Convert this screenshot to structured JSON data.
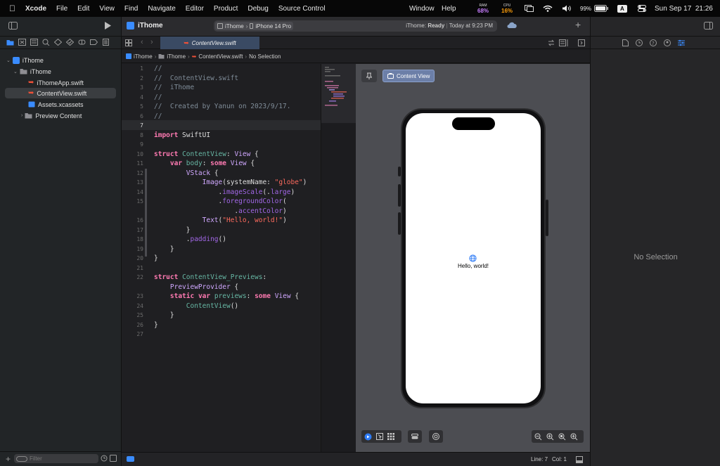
{
  "menubar": {
    "app": "Xcode",
    "items": [
      "File",
      "Edit",
      "View",
      "Find",
      "Navigate",
      "Editor",
      "Product",
      "Debug",
      "Source Control"
    ],
    "right_items": [
      "Window",
      "Help"
    ],
    "ram_label": "RAM",
    "ram_value": "68%",
    "cpu_label": "CPU",
    "cpu_value": "16%",
    "battery": "99%",
    "input_indicator": "A",
    "clock": "Sun Sep 17  21:26"
  },
  "toolbar": {
    "project": "iThome",
    "scheme": "iThome",
    "destination": "iPhone 14 Pro",
    "status_prefix": "iThome:",
    "status_state": "Ready",
    "status_time": "Today at 9:23 PM"
  },
  "navigator": {
    "tree": [
      {
        "label": "iThome",
        "icon": "project-icon"
      },
      {
        "label": "iThome",
        "icon": "folder-icon"
      },
      {
        "label": "iThomeApp.swift",
        "icon": "swift-file-icon"
      },
      {
        "label": "ContentView.swift",
        "icon": "swift-file-icon"
      },
      {
        "label": "Assets.xcassets",
        "icon": "asset-catalog-icon"
      },
      {
        "label": "Preview Content",
        "icon": "folder-icon"
      }
    ],
    "filter_placeholder": "Filter"
  },
  "editor": {
    "tab": "ContentView.swift",
    "jump_bar": [
      "iThome",
      "iThome",
      "ContentView.swift",
      "No Selection"
    ],
    "line_numbers": [
      "1",
      "2",
      "3",
      "4",
      "5",
      "6",
      "7",
      "8",
      "9",
      "10",
      "11",
      "12",
      "13",
      "14",
      "15",
      "",
      "16",
      "17",
      "18",
      "19",
      "20",
      "21",
      "22",
      "",
      "23",
      "24",
      "25",
      "26",
      "27"
    ],
    "code_lines": [
      "//",
      "//  ContentView.swift",
      "//  iThome",
      "//",
      "//  Created by Yanun on 2023/9/17.",
      "//",
      "",
      "import SwiftUI",
      "",
      "struct ContentView: View {",
      "    var body: some View {",
      "        VStack {",
      "            Image(systemName: \"globe\")",
      "                .imageScale(.large)",
      "                .foregroundColor(",
      "                    .accentColor)",
      "            Text(\"Hello, world!\")",
      "        }",
      "        .padding()",
      "    }",
      "}",
      "",
      "struct ContentView_Previews:",
      "    PreviewProvider {",
      "    static var previews: some View {",
      "        ContentView()",
      "    }",
      "}",
      ""
    ],
    "status_line": "Line: 7",
    "status_col": "Col: 1"
  },
  "canvas": {
    "preview_label": "Content View",
    "preview_text": "Hello, world!",
    "globe_icon": "globe-icon",
    "accent_color": "#2f7cf6"
  },
  "inspector": {
    "empty_label": "No Selection"
  }
}
